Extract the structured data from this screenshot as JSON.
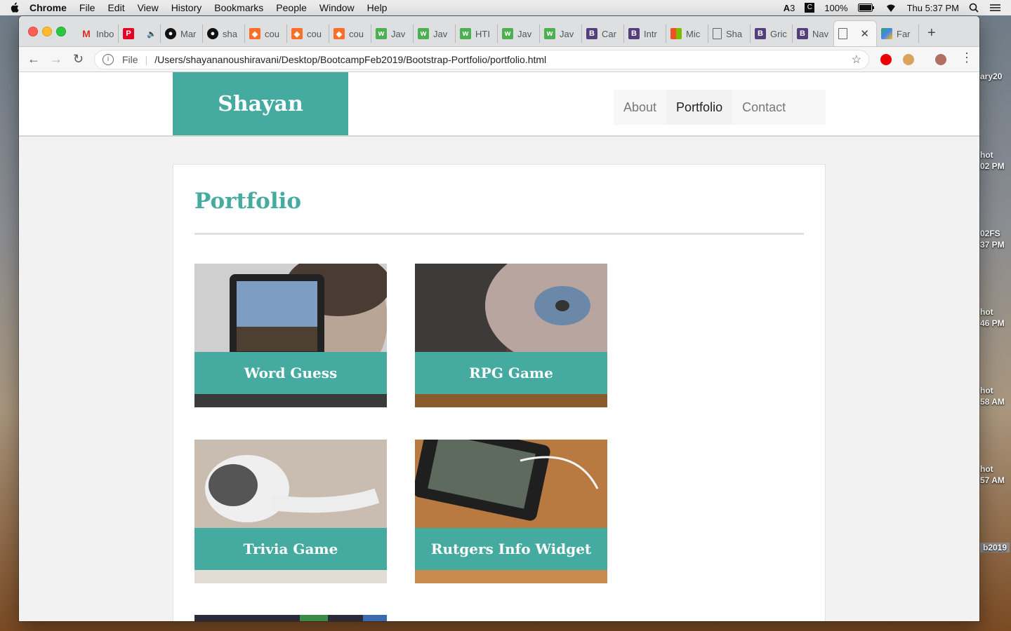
{
  "menubar": {
    "app": "Chrome",
    "items": [
      "File",
      "Edit",
      "View",
      "History",
      "Bookmarks",
      "People",
      "Window",
      "Help"
    ],
    "status": {
      "adobe": "3",
      "battery": "100%",
      "clock": "Thu 5:37 PM"
    }
  },
  "desktop": [
    "ary20",
    "hot",
    "02 PM",
    "02FS",
    "37 PM",
    "hot",
    "46 PM",
    "hot",
    "58 AM",
    "hot",
    "57 AM",
    "b2019"
  ],
  "tabs": [
    {
      "label": "Inbo",
      "icon": "gmail-icon"
    },
    {
      "label": "",
      "icon": "pinterest-icon"
    },
    {
      "label": "Mar",
      "icon": "github-icon"
    },
    {
      "label": "sha",
      "icon": "github-icon"
    },
    {
      "label": "cou",
      "icon": "gitlab-icon"
    },
    {
      "label": "cou",
      "icon": "gitlab-icon"
    },
    {
      "label": "cou",
      "icon": "gitlab-icon"
    },
    {
      "label": "Jav",
      "icon": "w3schools-icon"
    },
    {
      "label": "Jav",
      "icon": "w3schools-icon"
    },
    {
      "label": "HTI",
      "icon": "w3schools-icon"
    },
    {
      "label": "Jav",
      "icon": "w3schools-icon"
    },
    {
      "label": "Jav",
      "icon": "w3schools-icon"
    },
    {
      "label": "Car",
      "icon": "bootstrap-icon"
    },
    {
      "label": "Intr",
      "icon": "bootstrap-icon"
    },
    {
      "label": "Mic",
      "icon": "microsoft-icon"
    },
    {
      "label": "Sha",
      "icon": "document-icon"
    },
    {
      "label": "Gric",
      "icon": "bootstrap-icon"
    },
    {
      "label": "Nav",
      "icon": "bootstrap-icon"
    },
    {
      "label": "",
      "icon": "document-icon",
      "active": true
    },
    {
      "label": "Far",
      "icon": "maps-icon"
    }
  ],
  "toolbar": {
    "scheme": "File",
    "url": "/Users/shayananoushiravani/Desktop/BootcampFeb2019/Bootstrap-Portfolio/portfolio.html"
  },
  "site": {
    "brand": "Shayan",
    "nav": [
      {
        "label": "About",
        "active": false
      },
      {
        "label": "Portfolio",
        "active": true
      },
      {
        "label": "Contact",
        "active": false
      }
    ],
    "heading": "Portfolio",
    "projects": [
      {
        "title": "Word Guess",
        "image": "tablet-photo"
      },
      {
        "title": "RPG Game",
        "image": "turntable-photo"
      },
      {
        "title": "Trivia Game",
        "image": "earbuds-photo"
      },
      {
        "title": "Rutgers Info Widget",
        "image": "phone-headphones-photo"
      }
    ]
  },
  "colors": {
    "accent": "#45aaa0"
  }
}
